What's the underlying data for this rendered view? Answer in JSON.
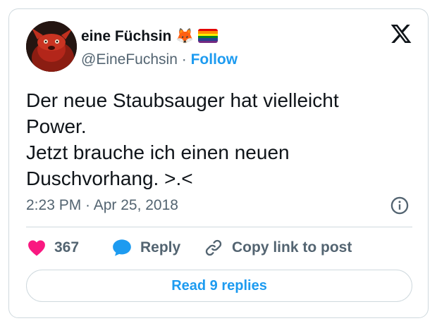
{
  "author": {
    "display_name": "eine Füchsin 🦊",
    "handle": "@EineFuchsin",
    "separator": "·",
    "follow_label": "Follow",
    "badge_icon": "rainbow-flag-icon"
  },
  "brand": {
    "logo_icon": "x-logo-icon"
  },
  "tweet": {
    "lines": [
      "Der neue Staubsauger hat vielleicht",
      "Power.",
      "Jetzt brauche ich einen neuen",
      "Duschvorhang. >.<"
    ],
    "timestamp": "2:23 PM · Apr 25, 2018",
    "info_icon": "info-icon"
  },
  "actions": {
    "likes_count": "367",
    "reply_label": "Reply",
    "copy_link_label": "Copy link to post",
    "read_replies_label": "Read 9 replies"
  },
  "colors": {
    "accent": "#1d9bf0",
    "like": "#f91880",
    "text_primary": "#0f1419",
    "text_secondary": "#536471",
    "border": "#cfd9de",
    "flag": [
      "#e40303",
      "#ff8c00",
      "#ffed00",
      "#008026",
      "#24408e",
      "#732982"
    ]
  }
}
